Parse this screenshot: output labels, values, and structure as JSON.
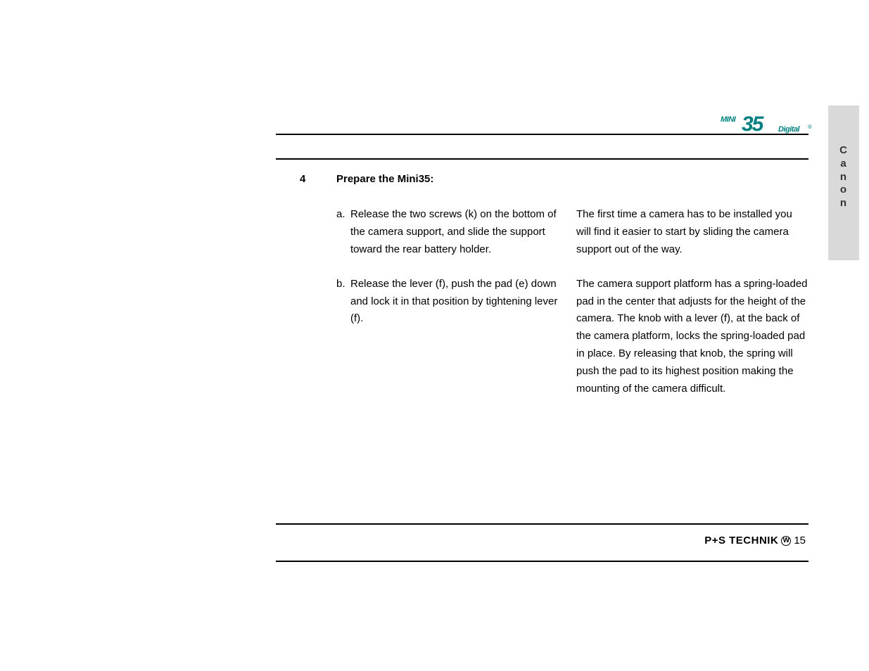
{
  "sideTab": {
    "letters": [
      "C",
      "a",
      "n",
      "o",
      "n"
    ]
  },
  "headerLogo": {
    "mini": "MINI",
    "number": "35",
    "digital": "Digital",
    "reg": "®"
  },
  "step": {
    "number": "4",
    "title": "Prepare the Mini35:",
    "items": [
      {
        "letter": "a.",
        "text": "Release the two screws (k) on the bottom of the camera support, and slide the support toward the rear battery holder."
      },
      {
        "letter": "b.",
        "text": "Release the lever (f), push the pad (e) down and lock it in that position by tightening lever (f)."
      }
    ],
    "notes": [
      "The first time a camera has to be installed you will find it easier to start by sliding the camera support out of the way.",
      "The camera support platform has a spring-loaded pad in the center that adjusts for the height of the camera. The knob with a lever (f), at the back of the camera platform, locks the spring-loaded pad in place. By releasing that knob, the spring will push the pad to its highest position making the mounting of the camera difficult."
    ]
  },
  "footer": {
    "brandPrefix": "P",
    "brandPlus": "+",
    "brandMid": "S TECHNIK",
    "circled": "W",
    "pageNumber": "15"
  }
}
